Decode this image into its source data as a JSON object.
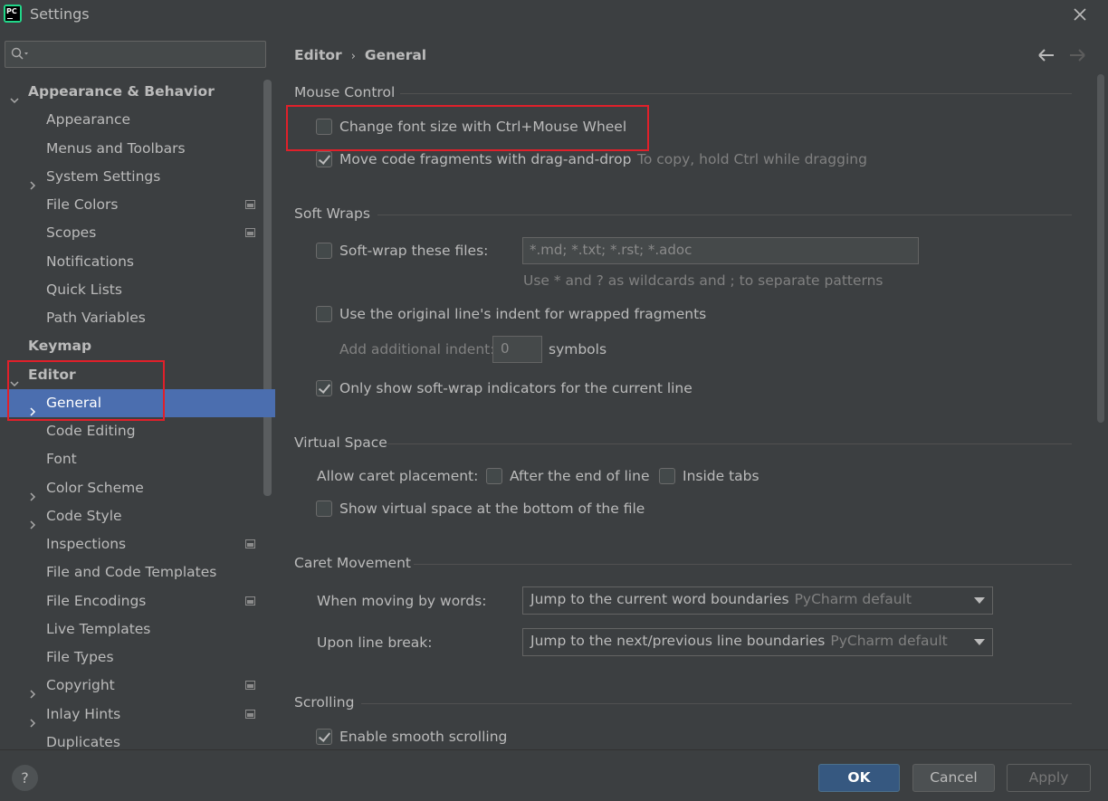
{
  "window": {
    "title": "Settings",
    "app_icon_text": "PC"
  },
  "sidebar": {
    "search_placeholder": "",
    "items": [
      {
        "label": "Appearance & Behavior",
        "bold": true,
        "expanded": true
      },
      {
        "label": "Appearance"
      },
      {
        "label": "Menus and Toolbars"
      },
      {
        "label": "System Settings",
        "collapsed": true
      },
      {
        "label": "File Colors",
        "project_icon": true
      },
      {
        "label": "Scopes",
        "project_icon": true
      },
      {
        "label": "Notifications"
      },
      {
        "label": "Quick Lists"
      },
      {
        "label": "Path Variables"
      },
      {
        "label": "Keymap",
        "bold": true
      },
      {
        "label": "Editor",
        "bold": true,
        "expanded": true
      },
      {
        "label": "General",
        "collapsed": true,
        "selected": true
      },
      {
        "label": "Code Editing"
      },
      {
        "label": "Font"
      },
      {
        "label": "Color Scheme",
        "collapsed": true
      },
      {
        "label": "Code Style",
        "collapsed": true
      },
      {
        "label": "Inspections",
        "project_icon": true
      },
      {
        "label": "File and Code Templates"
      },
      {
        "label": "File Encodings",
        "project_icon": true
      },
      {
        "label": "Live Templates"
      },
      {
        "label": "File Types"
      },
      {
        "label": "Copyright",
        "collapsed": true,
        "project_icon": true
      },
      {
        "label": "Inlay Hints",
        "collapsed": true,
        "project_icon": true
      },
      {
        "label": "Duplicates"
      }
    ]
  },
  "breadcrumb": {
    "parent": "Editor",
    "separator": "›",
    "current": "General"
  },
  "mouse_control": {
    "title": "Mouse Control",
    "change_font_size": {
      "label": "Change font size with Ctrl+Mouse Wheel",
      "checked": false
    },
    "move_code": {
      "label": "Move code fragments with drag-and-drop",
      "checked": true,
      "hint": "To copy, hold Ctrl while dragging"
    }
  },
  "soft_wraps": {
    "title": "Soft Wraps",
    "soft_wrap_files": {
      "label": "Soft-wrap these files:",
      "checked": false,
      "value": "*.md; *.txt; *.rst; *.adoc",
      "hint": "Use * and ? as wildcards and ; to separate patterns"
    },
    "original_indent": {
      "label": "Use the original line's indent for wrapped fragments",
      "checked": false
    },
    "additional_indent": {
      "label": "Add additional indent:",
      "value": "0",
      "suffix": "symbols"
    },
    "only_current_line": {
      "label": "Only show soft-wrap indicators for the current line",
      "checked": true
    }
  },
  "virtual_space": {
    "title": "Virtual Space",
    "caret_placement_label": "Allow caret placement:",
    "after_end_of_line": {
      "label": "After the end of line",
      "checked": false
    },
    "inside_tabs": {
      "label": "Inside tabs",
      "checked": false
    },
    "show_virtual_space": {
      "label": "Show virtual space at the bottom of the file",
      "checked": false
    }
  },
  "caret_movement": {
    "title": "Caret Movement",
    "moving_by_words": {
      "label": "When moving by words:",
      "value": "Jump to the current word boundaries",
      "default_tag": "PyCharm default"
    },
    "line_break": {
      "label": "Upon line break:",
      "value": "Jump to the next/previous line boundaries",
      "default_tag": "PyCharm default"
    }
  },
  "scrolling": {
    "title": "Scrolling",
    "smooth_scrolling": {
      "label": "Enable smooth scrolling",
      "checked": true
    }
  },
  "footer": {
    "help": "?",
    "ok": "OK",
    "cancel": "Cancel",
    "apply": "Apply"
  }
}
